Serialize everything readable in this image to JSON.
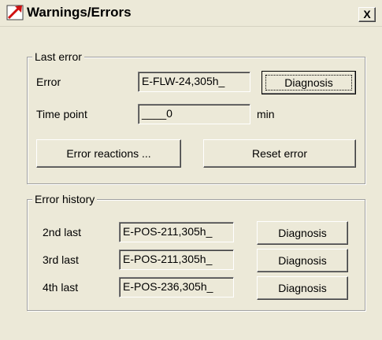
{
  "window": {
    "title": "Warnings/Errors",
    "close_label": "X"
  },
  "last_error": {
    "group_label": "Last error",
    "error_label": "Error",
    "error_value": "E-FLW-24,305h_",
    "diagnosis_label": "Diagnosis",
    "time_label": "Time point",
    "time_value": "____0",
    "time_unit": "min",
    "error_reactions_label": "Error reactions ...",
    "reset_error_label": "Reset error"
  },
  "error_history": {
    "group_label": "Error history",
    "rows": [
      {
        "label": "2nd last",
        "value": "E-POS-211,305h_",
        "button": "Diagnosis"
      },
      {
        "label": "3rd last",
        "value": "E-POS-211,305h_",
        "button": "Diagnosis"
      },
      {
        "label": "4th last",
        "value": "E-POS-236,305h_",
        "button": "Diagnosis"
      }
    ]
  },
  "icons": {
    "title_icon": "red-arrow-icon"
  },
  "colors": {
    "dialog_bg": "#ece9d8",
    "icon_red": "#d01010"
  }
}
